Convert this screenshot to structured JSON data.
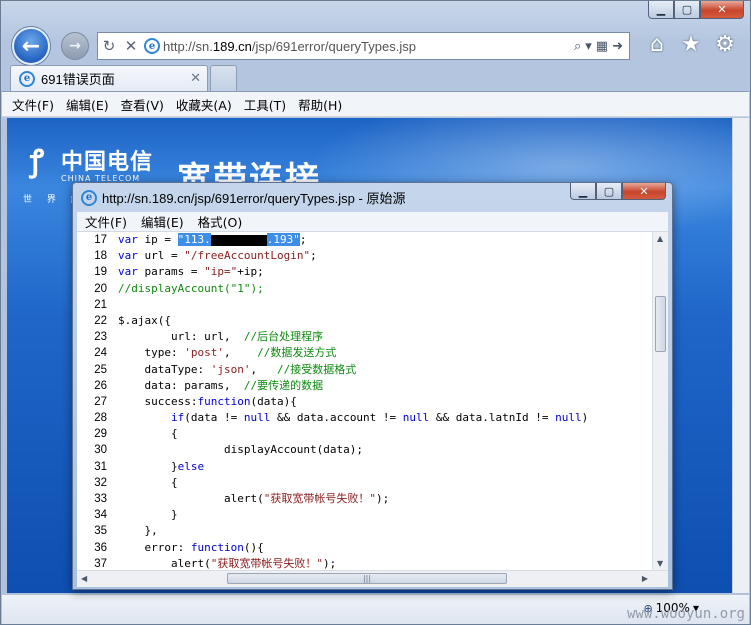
{
  "browser": {
    "address_url_prefix": "http://sn.",
    "address_url_host": "189.cn",
    "address_url_suffix": "/jsp/691error/queryTypes.jsp",
    "tab_title": "691错误页面",
    "menu": [
      "文件(F)",
      "编辑(E)",
      "查看(V)",
      "收藏夹(A)",
      "工具(T)",
      "帮助(H)"
    ],
    "zoom": "100%"
  },
  "page": {
    "logo_cn": "中国电信",
    "logo_en": "CHINA TELECOM",
    "slogan": "世 界 触 手 可 及",
    "title": "宽带连接"
  },
  "source_window": {
    "title": "http://sn.189.cn/jsp/691error/queryTypes.jsp - 原始源",
    "menu": [
      "文件(F)",
      "编辑(E)",
      "格式(O)"
    ],
    "lines": [
      {
        "n": "17",
        "parts": [
          [
            "kw",
            "var "
          ],
          [
            "plain",
            "ip = "
          ],
          [
            "hl",
            "\"113."
          ],
          [
            "redact",
            ""
          ],
          [
            "hl",
            ".193\""
          ],
          [
            "plain",
            ";"
          ]
        ]
      },
      {
        "n": "18",
        "parts": [
          [
            "kw",
            "var "
          ],
          [
            "plain",
            "url = "
          ],
          [
            "str",
            "\"/freeAccountLogin\""
          ],
          [
            "plain",
            ";"
          ]
        ]
      },
      {
        "n": "19",
        "parts": [
          [
            "kw",
            "var "
          ],
          [
            "plain",
            "params = "
          ],
          [
            "str",
            "\"ip=\""
          ],
          [
            "plain",
            "+ip;"
          ]
        ]
      },
      {
        "n": "20",
        "parts": [
          [
            "cmt",
            "//displayAccount(\"1\");"
          ]
        ]
      },
      {
        "n": "21",
        "parts": []
      },
      {
        "n": "22",
        "parts": [
          [
            "plain",
            "$.ajax({"
          ]
        ]
      },
      {
        "n": "23",
        "parts": [
          [
            "plain",
            "        url: url,  "
          ],
          [
            "cmt",
            "//后台处理程序"
          ]
        ]
      },
      {
        "n": "24",
        "parts": [
          [
            "plain",
            "    type: "
          ],
          [
            "str",
            "'post'"
          ],
          [
            "plain",
            ",    "
          ],
          [
            "cmt",
            "//数据发送方式"
          ]
        ]
      },
      {
        "n": "25",
        "parts": [
          [
            "plain",
            "    dataType: "
          ],
          [
            "str",
            "'json'"
          ],
          [
            "plain",
            ",   "
          ],
          [
            "cmt",
            "//接受数据格式"
          ]
        ]
      },
      {
        "n": "26",
        "parts": [
          [
            "plain",
            "    data: params,  "
          ],
          [
            "cmt",
            "//要传递的数据"
          ]
        ]
      },
      {
        "n": "27",
        "parts": [
          [
            "plain",
            "    success:"
          ],
          [
            "kw",
            "function"
          ],
          [
            "plain",
            "(data){"
          ]
        ]
      },
      {
        "n": "28",
        "parts": [
          [
            "plain",
            "        "
          ],
          [
            "kw",
            "if"
          ],
          [
            "plain",
            "(data != "
          ],
          [
            "kw",
            "null"
          ],
          [
            "plain",
            " && data.account != "
          ],
          [
            "kw",
            "null"
          ],
          [
            "plain",
            " && data.latnId != "
          ],
          [
            "kw",
            "null"
          ],
          [
            "plain",
            ")"
          ]
        ]
      },
      {
        "n": "29",
        "parts": [
          [
            "plain",
            "        {"
          ]
        ]
      },
      {
        "n": "30",
        "parts": [
          [
            "plain",
            "                displayAccount(data);"
          ]
        ]
      },
      {
        "n": "31",
        "parts": [
          [
            "plain",
            "        }"
          ],
          [
            "kw",
            "else"
          ]
        ]
      },
      {
        "n": "32",
        "parts": [
          [
            "plain",
            "        {"
          ]
        ]
      },
      {
        "n": "33",
        "parts": [
          [
            "plain",
            "                alert("
          ],
          [
            "str",
            "\"获取宽带帐号失败！\""
          ],
          [
            "plain",
            ");"
          ]
        ]
      },
      {
        "n": "34",
        "parts": [
          [
            "plain",
            "        }"
          ]
        ]
      },
      {
        "n": "35",
        "parts": [
          [
            "plain",
            "    },"
          ]
        ]
      },
      {
        "n": "36",
        "parts": [
          [
            "plain",
            "    error: "
          ],
          [
            "kw",
            "function"
          ],
          [
            "plain",
            "(){"
          ]
        ]
      },
      {
        "n": "37",
        "parts": [
          [
            "plain",
            "        alert("
          ],
          [
            "str",
            "\"获取宽带帐号失败！\""
          ],
          [
            "plain",
            ");"
          ]
        ]
      }
    ]
  },
  "watermark": "www.wooyun.org",
  "icons": {
    "back": "back-arrow-icon",
    "forward": "forward-arrow-icon",
    "refresh": "refresh-icon",
    "stop": "stop-icon",
    "home": "home-icon",
    "favorites": "star-icon",
    "tools": "gear-icon"
  }
}
